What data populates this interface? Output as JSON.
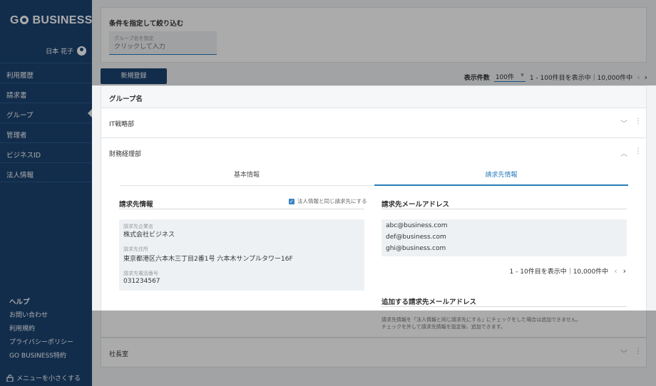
{
  "sidebar": {
    "logo": "GO BUSINESS",
    "user_name": "日本 花子",
    "nav": [
      {
        "label": "利用履歴"
      },
      {
        "label": "請求書"
      },
      {
        "label": "グループ"
      },
      {
        "label": "管理者"
      },
      {
        "label": "ビジネスID"
      },
      {
        "label": "法人情報"
      }
    ],
    "help_title": "ヘルプ",
    "help_links": [
      "お問い合わせ",
      "利用規約",
      "プライバシーポリシー",
      "GO BUSINESS特約"
    ],
    "collapse_label": "メニューを小さくする"
  },
  "filter": {
    "title": "条件を指定して絞り込む",
    "group_field_label": "グループ名を指定",
    "group_field_placeholder": "クリックして入力"
  },
  "toolbar": {
    "new_button": "新規登録",
    "per_page_label": "表示件数",
    "per_page_value": "100件",
    "range_text": "1 - 100件目を表示中｜10,000件中"
  },
  "list": {
    "header": "グループ名",
    "rows": [
      {
        "name": "IT戦略部"
      },
      {
        "name": "財務経理部"
      },
      {
        "name": "社長室"
      }
    ]
  },
  "detail": {
    "tabs": [
      "基本情報",
      "請求先情報"
    ],
    "billing": {
      "title": "請求先情報",
      "same_as_corp_label": "法人情報と同じ請求先にする",
      "company_label": "請求先企業名",
      "company_value": "株式会社ビジネス",
      "address_label": "請求先住所",
      "address_value": "東京都港区六本木三丁目2番1号 六本木サンプルタワー16F",
      "phone_label": "請求先電話番号",
      "phone_value": "031234567"
    },
    "emails": {
      "title": "請求先メールアドレス",
      "items": [
        "abc@business.com",
        "def@business.com",
        "ghi@business.com"
      ],
      "range_text": "1 - 10件目を表示中｜10,000件中"
    },
    "add_email": {
      "title": "追加する請求先メールアドレス",
      "note_1": "請求先情報を「法人情報と同じ請求先にする」にチェックをした場合は追加できません。",
      "note_2": "チェックを外して請求先情報を設定後、追加できます。"
    }
  },
  "colors": {
    "sidebar": "#1b4372",
    "accent": "#2a7db9",
    "overlay": "rgba(0,0,0,0.33)"
  }
}
